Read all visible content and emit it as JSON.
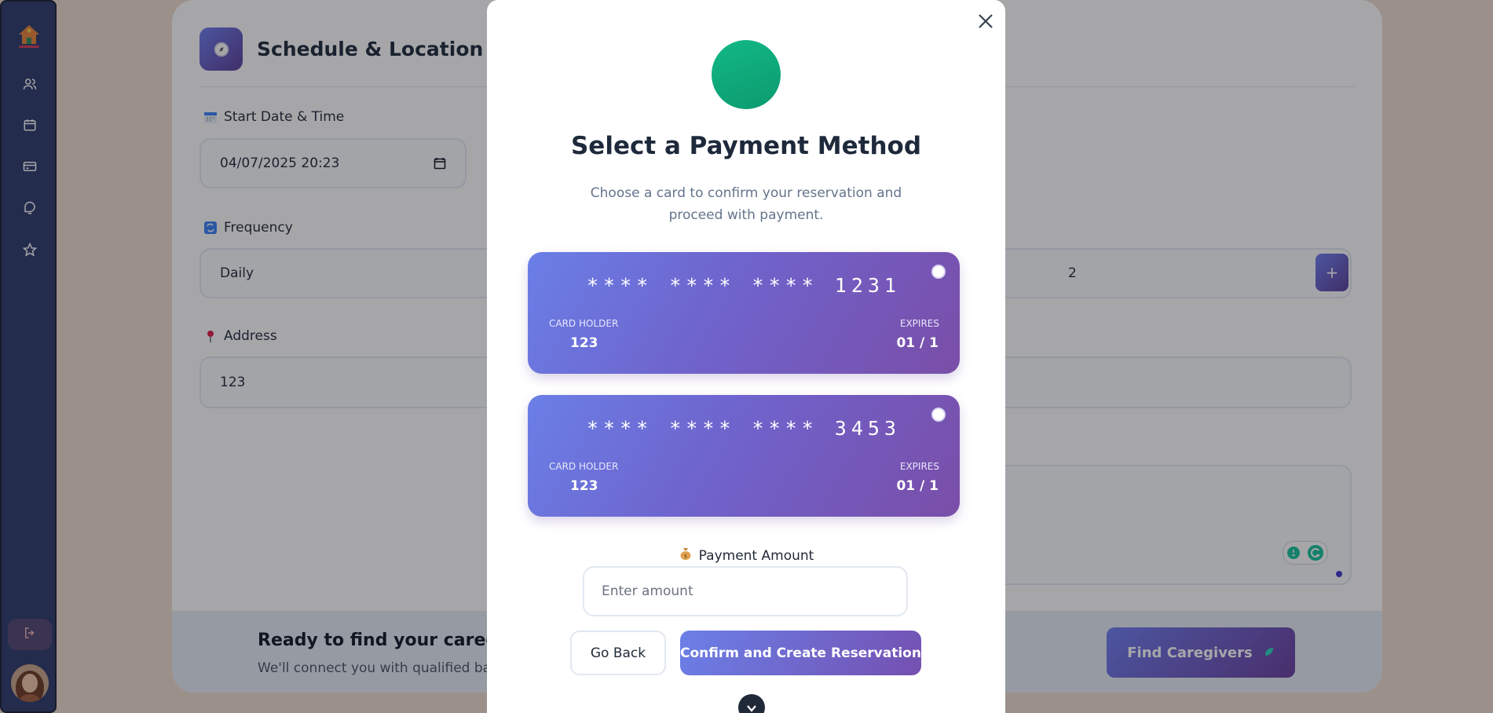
{
  "section": {
    "title": "Schedule & Location"
  },
  "fields": {
    "start_label": "Start Date & Time",
    "start_value": "04/07/2025 20:23",
    "frequency_label": "Frequency",
    "frequency_value": "Daily",
    "count_value": "2",
    "address_label": "Address",
    "address_value": "123"
  },
  "footer": {
    "title": "Ready to find your caregiver",
    "subtitle": "We'll connect you with qualified baby",
    "find_button": "Find Caregivers"
  },
  "modal": {
    "title": "Select a Payment Method",
    "subtitle": "Choose a card to confirm your reservation and proceed with payment.",
    "cards": [
      {
        "number": "**** **** **** 1231",
        "holder_label": "CARD HOLDER",
        "holder": "123",
        "expires_label": "EXPIRES",
        "expires": "01 / 1"
      },
      {
        "number": "**** **** **** 3453",
        "holder_label": "CARD HOLDER",
        "holder": "123",
        "expires_label": "EXPIRES",
        "expires": "01 / 1"
      }
    ],
    "amount_label": "Payment Amount",
    "amount_placeholder": "Enter amount",
    "back_button": "Go Back",
    "confirm_button": "Confirm and Create Reservation"
  },
  "icons": {
    "sidebar": [
      "users-icon",
      "calendar-icon",
      "credit-card-icon",
      "chat-icon",
      "star-icon"
    ],
    "logout": "logout-icon",
    "close": "close-icon",
    "calendar_picker": "calendar-picker-icon",
    "money_bag": "money-bag-icon",
    "pin": "map-pin-icon"
  },
  "colors": {
    "accent_start": "#6e7ef0",
    "accent_end": "#6a3f9e",
    "badge": "#12b886",
    "sidebar": "#2e3a6b"
  }
}
